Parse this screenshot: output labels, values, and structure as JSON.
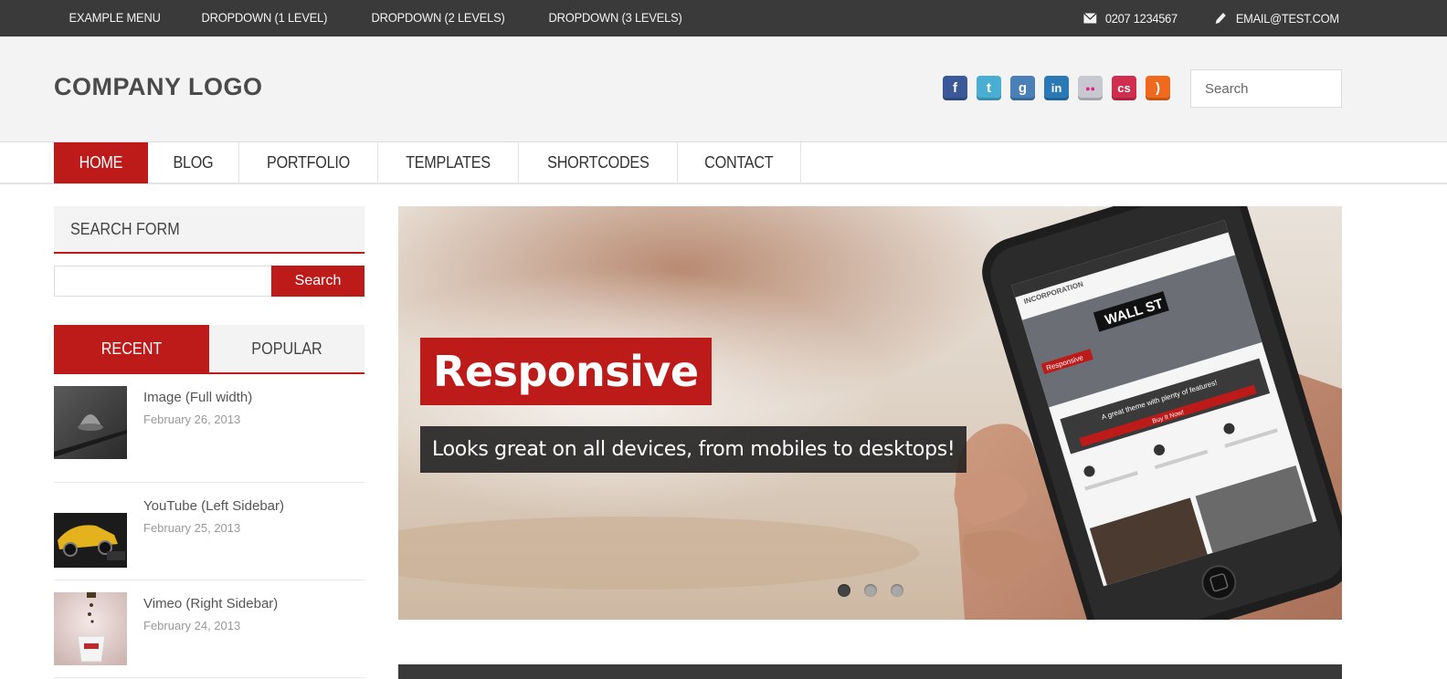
{
  "topbar": {
    "menu": [
      {
        "label": "EXAMPLE MENU"
      },
      {
        "label": "DROPDOWN (1 LEVEL)"
      },
      {
        "label": "DROPDOWN (2 LEVELS)"
      },
      {
        "label": "DROPDOWN (3 LEVELS)"
      }
    ],
    "phone": "0207 1234567",
    "email": "EMAIL@TEST.COM"
  },
  "header": {
    "logo": "COMPANY LOGO",
    "search_placeholder": "Search",
    "socials": [
      {
        "icon": "facebook-icon",
        "glyph": "f",
        "color": "#3b5998"
      },
      {
        "icon": "twitter-icon",
        "glyph": "t",
        "color": "#4aaed3"
      },
      {
        "icon": "google-icon",
        "glyph": "g",
        "color": "#4a7fb8"
      },
      {
        "icon": "linkedin-icon",
        "glyph": "in",
        "color": "#2a79b6"
      },
      {
        "icon": "flickr-icon",
        "glyph": "●●",
        "color": "#c8c8d0"
      },
      {
        "icon": "lastfm-icon",
        "glyph": "cs",
        "color": "#d12d4e"
      },
      {
        "icon": "rss-icon",
        "glyph": ")",
        "color": "#f06a1e"
      }
    ]
  },
  "nav": {
    "items": [
      {
        "label": "HOME",
        "active": true
      },
      {
        "label": "BLOG"
      },
      {
        "label": "PORTFOLIO"
      },
      {
        "label": "TEMPLATES"
      },
      {
        "label": "SHORTCODES"
      },
      {
        "label": "CONTACT"
      }
    ]
  },
  "sidebar": {
    "search_title": "SEARCH FORM",
    "search_button": "Search",
    "tabs": [
      "RECENT",
      "POPULAR"
    ],
    "posts": [
      {
        "title": "Image (Full width)",
        "date": "February 26, 2013"
      },
      {
        "title": "YouTube (Left Sidebar)",
        "date": "February 25, 2013"
      },
      {
        "title": "Vimeo (Right Sidebar)",
        "date": "February 24, 2013"
      }
    ]
  },
  "slider": {
    "title": "Responsive",
    "caption": "Looks great on all devices, from mobiles to desktops!",
    "dots": 3,
    "active_dot": 1,
    "phone_screen": {
      "brand": "INCORPORATION",
      "sign": "WALL ST",
      "badge": "Responsive",
      "headline": "A great theme with plenty of features!",
      "button": "Buy It Now!"
    }
  },
  "colors": {
    "accent": "#bd1a1a",
    "dark": "#3a3a3a"
  }
}
